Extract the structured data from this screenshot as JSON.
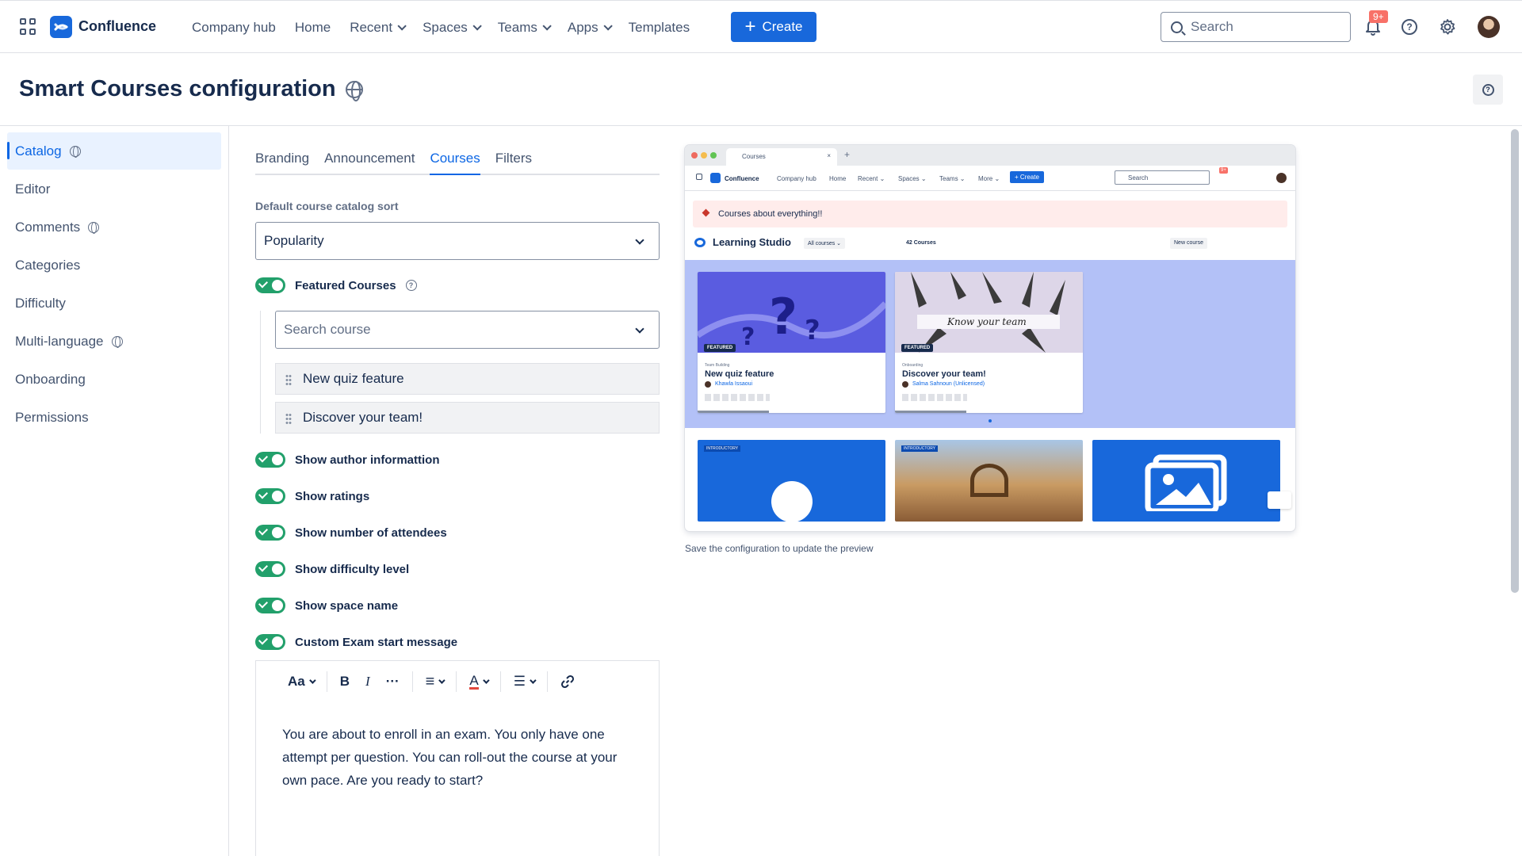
{
  "topnav": {
    "brand": "Confluence",
    "items": [
      {
        "label": "Company hub",
        "dropdown": false
      },
      {
        "label": "Home",
        "dropdown": false
      },
      {
        "label": "Recent",
        "dropdown": true
      },
      {
        "label": "Spaces",
        "dropdown": true
      },
      {
        "label": "Teams",
        "dropdown": true
      },
      {
        "label": "Apps",
        "dropdown": true
      },
      {
        "label": "Templates",
        "dropdown": false
      }
    ],
    "create_label": "Create",
    "search_placeholder": "Search",
    "notifications_badge": "9+"
  },
  "page": {
    "title": "Smart Courses configuration"
  },
  "sidebar": {
    "items": [
      {
        "label": "Catalog",
        "globe": true,
        "active": true
      },
      {
        "label": "Editor",
        "globe": false,
        "active": false
      },
      {
        "label": "Comments",
        "globe": true,
        "active": false
      },
      {
        "label": "Categories",
        "globe": false,
        "active": false
      },
      {
        "label": "Difficulty",
        "globe": false,
        "active": false
      },
      {
        "label": "Multi-language",
        "globe": true,
        "active": false
      },
      {
        "label": "Onboarding",
        "globe": false,
        "active": false
      },
      {
        "label": "Permissions",
        "globe": false,
        "active": false
      }
    ]
  },
  "config": {
    "tabs": [
      {
        "label": "Branding",
        "active": false
      },
      {
        "label": "Announcement",
        "active": false
      },
      {
        "label": "Courses",
        "active": true
      },
      {
        "label": "Filters",
        "active": false
      }
    ],
    "sort_label": "Default course catalog sort",
    "sort_value": "Popularity",
    "featured_label": "Featured Courses",
    "search_course_placeholder": "Search course",
    "featured_courses": [
      "New quiz feature",
      "Discover your team!"
    ],
    "toggles": [
      "Show author informattion",
      "Show ratings",
      "Show number of attendees",
      "Show difficulty level",
      "Show space name",
      "Custom Exam start message"
    ],
    "editor": {
      "toolbar": {
        "text_style": "Aa",
        "bold": "B",
        "italic": "I",
        "more": "···",
        "align": "≡",
        "color": "A",
        "list": "☰"
      },
      "text": "You are about to enroll in an exam. You only have one attempt per question. You can roll-out the course at your own pace. Are you ready to start?"
    }
  },
  "preview": {
    "tab_title": "Courses",
    "nav": {
      "brand": "Confluence",
      "items": [
        "Company hub",
        "Home",
        "Recent ⌄",
        "Spaces ⌄",
        "Teams ⌄",
        "More ⌄"
      ],
      "create": "+ Create",
      "search": "Search",
      "badge": "9+"
    },
    "banner": "Courses about everything!!",
    "studio_title": "Learning Studio",
    "all_courses": "All courses ⌄",
    "count": "42 Courses",
    "new_course": "New course",
    "featured_tag": "FEATURED",
    "introductory_tag": "INTRODUCTORY",
    "know_your_team": "Know your team",
    "cards": [
      {
        "category": "Team Building",
        "title": "New quiz feature",
        "author": "Khawla Issaoui"
      },
      {
        "category": "Onboarding",
        "title": "Discover your team!",
        "author": "Salma Sahnoun (Unlicensed)"
      }
    ],
    "caption": "Save the configuration to update the preview"
  },
  "colors": {
    "brand_blue": "#1868db",
    "toggle_green": "#22a06b",
    "active_blue": "#0c66e4"
  }
}
